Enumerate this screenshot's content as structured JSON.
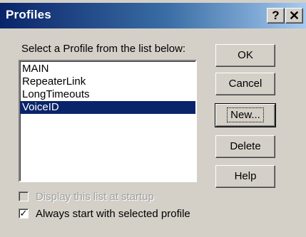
{
  "window": {
    "title": "Profiles",
    "help_button": "?",
    "close_button": "✕"
  },
  "profiles": {
    "prompt": "Select a Profile from the list below:",
    "items": [
      {
        "label": "MAIN",
        "selected": false
      },
      {
        "label": "RepeaterLink",
        "selected": false
      },
      {
        "label": "LongTimeouts",
        "selected": false
      },
      {
        "label": "VoiceID",
        "selected": true
      }
    ]
  },
  "buttons": {
    "ok": "OK",
    "cancel": "Cancel",
    "new": "New...",
    "delete": "Delete",
    "help": "Help"
  },
  "options": {
    "display_at_startup": {
      "label": "Display this list at startup",
      "checked": false,
      "enabled": false
    },
    "always_start_selected": {
      "label": "Always start with selected profile",
      "checked": true,
      "enabled": true
    }
  },
  "colors": {
    "selection": "#0a246a",
    "face": "#d4d0c8"
  }
}
